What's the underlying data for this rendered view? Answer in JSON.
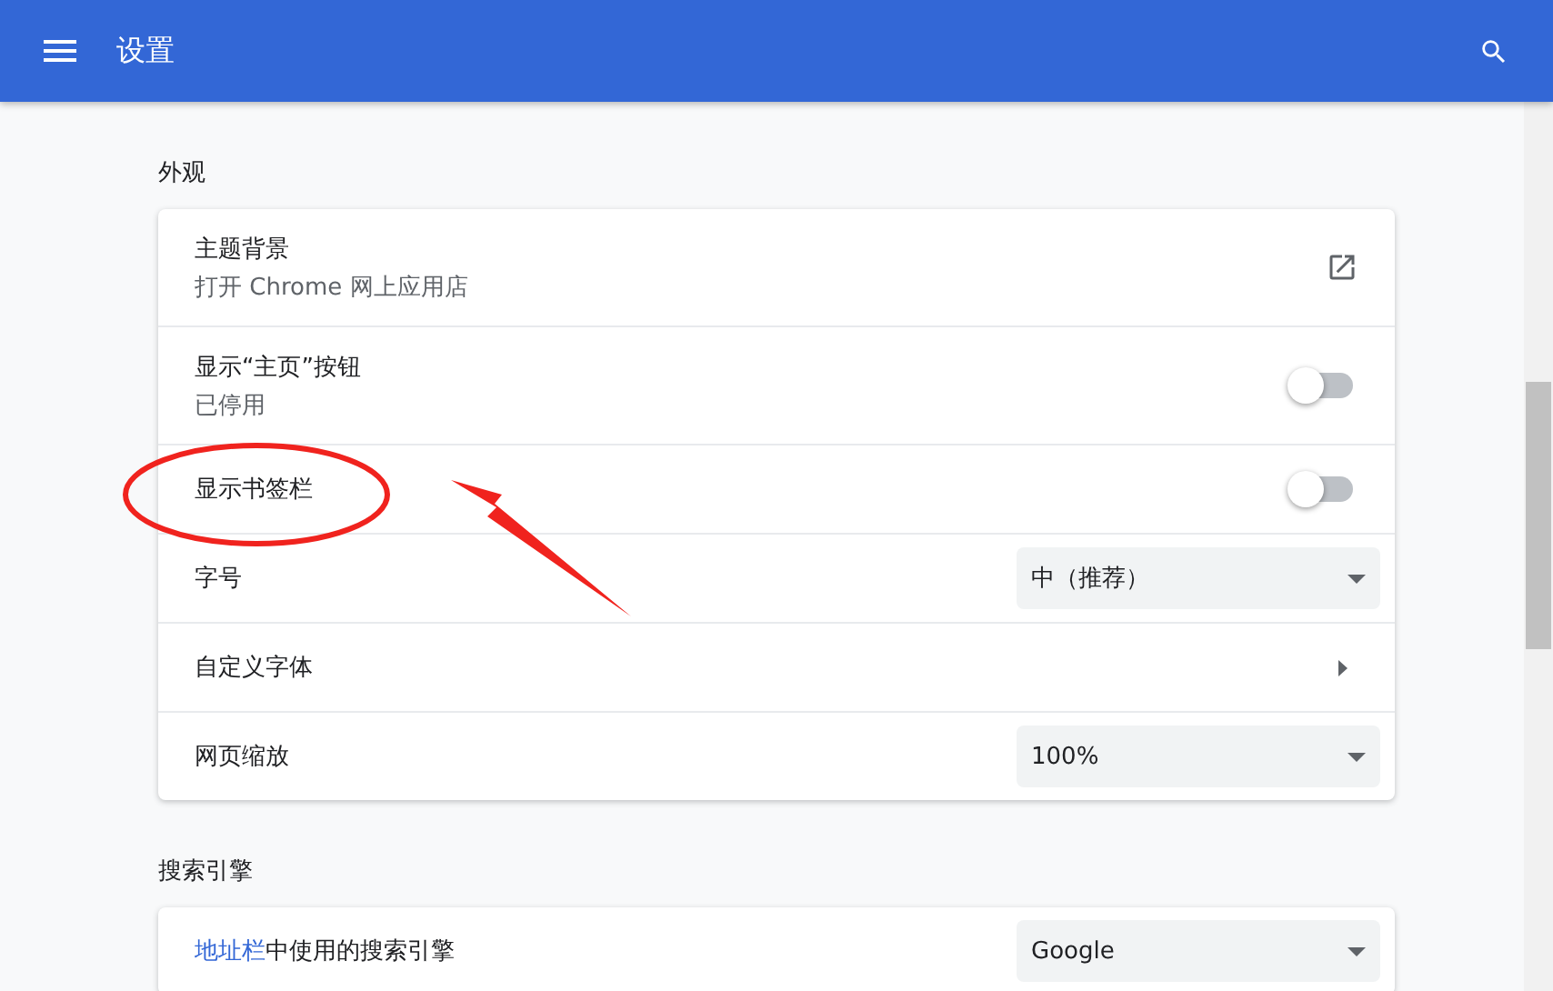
{
  "header": {
    "title": "设置"
  },
  "sections": [
    {
      "title": "外观",
      "rows": [
        {
          "kind": "external",
          "label": "主题背景",
          "sublabel": "打开 Chrome 网上应用店"
        },
        {
          "kind": "toggle",
          "label": "显示“主页”按钮",
          "sublabel": "已停用",
          "on": false
        },
        {
          "kind": "toggle",
          "label": "显示书签栏",
          "on": false
        },
        {
          "kind": "select",
          "label": "字号",
          "value": "中（推荐）"
        },
        {
          "kind": "submenu",
          "label": "自定义字体"
        },
        {
          "kind": "select",
          "label": "网页缩放",
          "value": "100%"
        }
      ]
    },
    {
      "title": "搜索引擎",
      "rows": [
        {
          "kind": "select",
          "label_link": "地址栏",
          "label": "中使用的搜索引擎",
          "value": "Google"
        }
      ]
    }
  ]
}
